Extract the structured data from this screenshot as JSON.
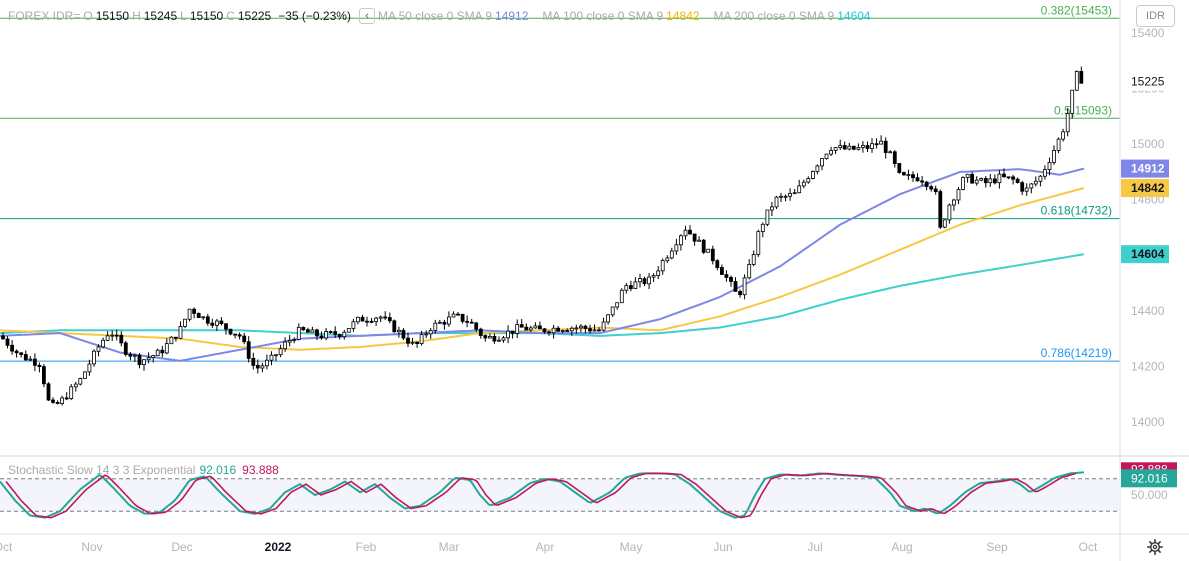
{
  "header": {
    "symbol": "FOREX IDR=",
    "open_label": "O",
    "open": "15150",
    "high_label": "H",
    "high": "15245",
    "low_label": "L",
    "low": "15150",
    "close_label": "C",
    "close": "15225",
    "change": "−35 (−0.23%)",
    "collapse_glyph": "‹",
    "ma50_label": "MA 50 close 0 SMA 9",
    "ma50_value": "14912",
    "ma100_label": "MA 100 close 0 SMA 9",
    "ma100_value": "14842",
    "ma200_label": "MA 200 close 0 SMA 9",
    "ma200_value": "14604"
  },
  "symbol_button": "IDR",
  "stochastic": {
    "label": "Stochastic Slow 14 3 3 Exponential",
    "k_value": "92.016",
    "d_value": "93.888",
    "upper_band": 80,
    "lower_band": 20,
    "axis_label": "50.000",
    "k_color": "#26a69a",
    "d_color": "#c2185b"
  },
  "chart_data": {
    "type": "candlestick",
    "yaxis_ticks": [
      "14000",
      "14200",
      "14400",
      "14600",
      "14800",
      "15000",
      "15200",
      "15400"
    ],
    "ylim": [
      13880,
      15480
    ],
    "xaxis_labels": [
      "Oct",
      "Nov",
      "Dec",
      "2022",
      "Feb",
      "Mar",
      "Apr",
      "May",
      "Jun",
      "Jul",
      "Aug",
      "Sep",
      "Oct"
    ],
    "last_price_label": "15225",
    "fib_levels": [
      {
        "label": "0.382(15453)",
        "value": 15453,
        "color": "#4caf50"
      },
      {
        "label": "0.5(15093)",
        "value": 15093,
        "color": "#4caf50"
      },
      {
        "label": "0.618(14732)",
        "value": 14732,
        "color": "#089981"
      },
      {
        "label": "0.786(14219)",
        "value": 14219,
        "color": "#2196f3"
      }
    ],
    "moving_averages": [
      {
        "name": "MA 50",
        "last": 14912,
        "color": "#7f86e8"
      },
      {
        "name": "MA 100",
        "last": 14842,
        "color": "#f7c843"
      },
      {
        "name": "MA 200",
        "last": 14604,
        "color": "#3fd0cd"
      }
    ],
    "price_anchors": [
      [
        0,
        14310
      ],
      [
        20,
        14240
      ],
      [
        40,
        14210
      ],
      [
        50,
        14050
      ],
      [
        60,
        14070
      ],
      [
        80,
        14150
      ],
      [
        100,
        14280
      ],
      [
        110,
        14330
      ],
      [
        125,
        14260
      ],
      [
        140,
        14220
      ],
      [
        160,
        14250
      ],
      [
        180,
        14330
      ],
      [
        190,
        14410
      ],
      [
        205,
        14370
      ],
      [
        215,
        14360
      ],
      [
        240,
        14310
      ],
      [
        255,
        14190
      ],
      [
        270,
        14220
      ],
      [
        285,
        14280
      ],
      [
        300,
        14330
      ],
      [
        320,
        14310
      ],
      [
        340,
        14320
      ],
      [
        360,
        14370
      ],
      [
        380,
        14380
      ],
      [
        400,
        14320
      ],
      [
        415,
        14270
      ],
      [
        430,
        14340
      ],
      [
        455,
        14380
      ],
      [
        470,
        14360
      ],
      [
        485,
        14300
      ],
      [
        500,
        14310
      ],
      [
        520,
        14340
      ],
      [
        540,
        14330
      ],
      [
        560,
        14340
      ],
      [
        580,
        14340
      ],
      [
        600,
        14330
      ],
      [
        615,
        14420
      ],
      [
        625,
        14490
      ],
      [
        650,
        14510
      ],
      [
        665,
        14590
      ],
      [
        685,
        14700
      ],
      [
        700,
        14640
      ],
      [
        715,
        14580
      ],
      [
        728,
        14510
      ],
      [
        738,
        14450
      ],
      [
        750,
        14560
      ],
      [
        760,
        14700
      ],
      [
        775,
        14800
      ],
      [
        795,
        14820
      ],
      [
        815,
        14920
      ],
      [
        830,
        14990
      ],
      [
        850,
        14980
      ],
      [
        870,
        14990
      ],
      [
        880,
        15010
      ],
      [
        890,
        14960
      ],
      [
        900,
        14880
      ],
      [
        920,
        14880
      ],
      [
        935,
        14840
      ],
      [
        940,
        14690
      ],
      [
        950,
        14790
      ],
      [
        965,
        14880
      ],
      [
        985,
        14860
      ],
      [
        1000,
        14880
      ],
      [
        1015,
        14870
      ],
      [
        1025,
        14830
      ],
      [
        1040,
        14880
      ],
      [
        1050,
        14950
      ],
      [
        1062,
        15040
      ],
      [
        1070,
        15140
      ],
      [
        1076,
        15250
      ],
      [
        1084,
        15225
      ]
    ],
    "ma50_anchors": [
      [
        0,
        14310
      ],
      [
        60,
        14320
      ],
      [
        120,
        14250
      ],
      [
        180,
        14220
      ],
      [
        240,
        14260
      ],
      [
        300,
        14300
      ],
      [
        360,
        14310
      ],
      [
        420,
        14320
      ],
      [
        480,
        14330
      ],
      [
        540,
        14320
      ],
      [
        600,
        14320
      ],
      [
        660,
        14370
      ],
      [
        720,
        14450
      ],
      [
        780,
        14560
      ],
      [
        840,
        14710
      ],
      [
        900,
        14820
      ],
      [
        960,
        14900
      ],
      [
        1020,
        14910
      ],
      [
        1060,
        14890
      ],
      [
        1084,
        14912
      ]
    ],
    "ma100_anchors": [
      [
        0,
        14330
      ],
      [
        60,
        14320
      ],
      [
        120,
        14310
      ],
      [
        180,
        14300
      ],
      [
        240,
        14270
      ],
      [
        300,
        14260
      ],
      [
        360,
        14270
      ],
      [
        420,
        14290
      ],
      [
        480,
        14320
      ],
      [
        540,
        14330
      ],
      [
        600,
        14340
      ],
      [
        660,
        14330
      ],
      [
        720,
        14380
      ],
      [
        780,
        14450
      ],
      [
        840,
        14530
      ],
      [
        900,
        14620
      ],
      [
        960,
        14710
      ],
      [
        1020,
        14780
      ],
      [
        1084,
        14842
      ]
    ],
    "ma200_anchors": [
      [
        0,
        14320
      ],
      [
        60,
        14330
      ],
      [
        120,
        14330
      ],
      [
        180,
        14330
      ],
      [
        240,
        14330
      ],
      [
        300,
        14320
      ],
      [
        360,
        14310
      ],
      [
        420,
        14320
      ],
      [
        480,
        14320
      ],
      [
        540,
        14320
      ],
      [
        600,
        14310
      ],
      [
        660,
        14320
      ],
      [
        720,
        14340
      ],
      [
        780,
        14380
      ],
      [
        840,
        14440
      ],
      [
        900,
        14490
      ],
      [
        960,
        14530
      ],
      [
        1020,
        14565
      ],
      [
        1084,
        14604
      ]
    ],
    "stoch_anchors": [
      [
        0,
        75
      ],
      [
        15,
        40
      ],
      [
        30,
        12
      ],
      [
        45,
        8
      ],
      [
        60,
        20
      ],
      [
        80,
        60
      ],
      [
        100,
        88
      ],
      [
        115,
        60
      ],
      [
        130,
        30
      ],
      [
        145,
        15
      ],
      [
        160,
        18
      ],
      [
        175,
        40
      ],
      [
        190,
        78
      ],
      [
        205,
        85
      ],
      [
        220,
        55
      ],
      [
        240,
        20
      ],
      [
        255,
        15
      ],
      [
        270,
        25
      ],
      [
        285,
        55
      ],
      [
        300,
        70
      ],
      [
        315,
        50
      ],
      [
        330,
        60
      ],
      [
        345,
        75
      ],
      [
        360,
        55
      ],
      [
        375,
        70
      ],
      [
        390,
        45
      ],
      [
        405,
        25
      ],
      [
        420,
        30
      ],
      [
        440,
        55
      ],
      [
        455,
        82
      ],
      [
        470,
        78
      ],
      [
        480,
        50
      ],
      [
        490,
        30
      ],
      [
        510,
        45
      ],
      [
        530,
        72
      ],
      [
        545,
        80
      ],
      [
        560,
        75
      ],
      [
        575,
        55
      ],
      [
        590,
        35
      ],
      [
        610,
        55
      ],
      [
        625,
        82
      ],
      [
        640,
        90
      ],
      [
        660,
        90
      ],
      [
        675,
        88
      ],
      [
        690,
        70
      ],
      [
        705,
        45
      ],
      [
        720,
        20
      ],
      [
        735,
        8
      ],
      [
        745,
        12
      ],
      [
        755,
        50
      ],
      [
        765,
        80
      ],
      [
        780,
        88
      ],
      [
        800,
        86
      ],
      [
        820,
        90
      ],
      [
        840,
        87
      ],
      [
        860,
        85
      ],
      [
        875,
        82
      ],
      [
        890,
        55
      ],
      [
        900,
        30
      ],
      [
        915,
        20
      ],
      [
        925,
        25
      ],
      [
        938,
        15
      ],
      [
        950,
        30
      ],
      [
        965,
        55
      ],
      [
        980,
        72
      ],
      [
        995,
        75
      ],
      [
        1010,
        80
      ],
      [
        1020,
        70
      ],
      [
        1030,
        55
      ],
      [
        1040,
        65
      ],
      [
        1055,
        82
      ],
      [
        1070,
        90
      ],
      [
        1084,
        92
      ]
    ]
  }
}
